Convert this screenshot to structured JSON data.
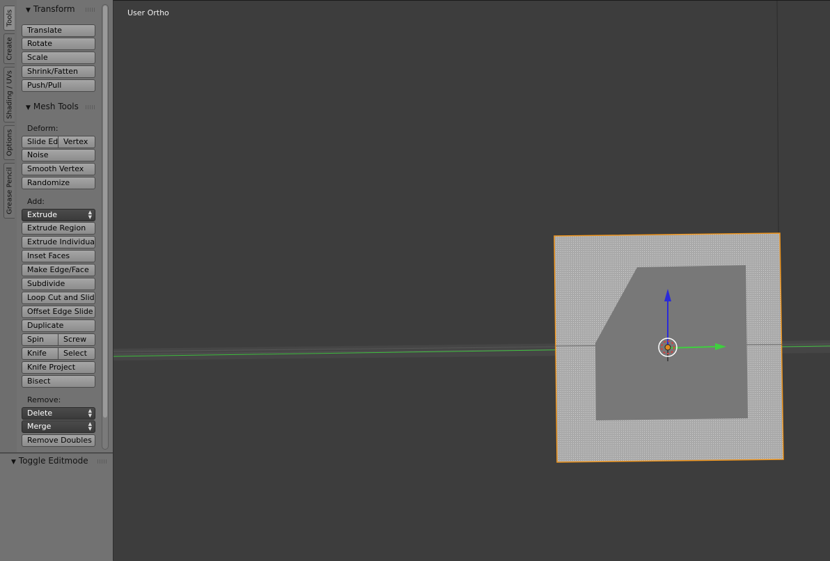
{
  "tabs": [
    "Tools",
    "Create",
    "Shading / UVs",
    "Options",
    "Grease Pencil"
  ],
  "transform_panel": {
    "title": "Transform",
    "buttons": [
      "Translate",
      "Rotate",
      "Scale",
      "Shrink/Fatten",
      "Push/Pull"
    ]
  },
  "mesh_tools_panel": {
    "title": "Mesh Tools",
    "deform_label": "Deform:",
    "slide_edge": "Slide Ed",
    "vertex": "Vertex",
    "noise": "Noise",
    "smooth_vertex": "Smooth Vertex",
    "randomize": "Randomize",
    "add_label": "Add:",
    "extrude_dropdown": "Extrude",
    "extrude_region": "Extrude Region",
    "extrude_individual": "Extrude Individual",
    "inset_faces": "Inset Faces",
    "make_edge_face": "Make Edge/Face",
    "subdivide": "Subdivide",
    "loop_cut": "Loop Cut and Slide",
    "offset_edge_slide": "Offset Edge Slide",
    "duplicate": "Duplicate",
    "spin": "Spin",
    "screw": "Screw",
    "knife": "Knife",
    "select": "Select",
    "knife_project": "Knife Project",
    "bisect": "Bisect",
    "remove_label": "Remove:",
    "delete_dropdown": "Delete",
    "merge_dropdown": "Merge",
    "remove_doubles": "Remove Doubles"
  },
  "toggle_panel": {
    "title": "Toggle Editmode"
  },
  "viewport": {
    "view_label": "User Ortho"
  },
  "colors": {
    "selection_outline": "#f0961e",
    "x_axis": "#3fcf3f",
    "z_axis": "#2a2adc",
    "background": "#3d3d3d"
  }
}
